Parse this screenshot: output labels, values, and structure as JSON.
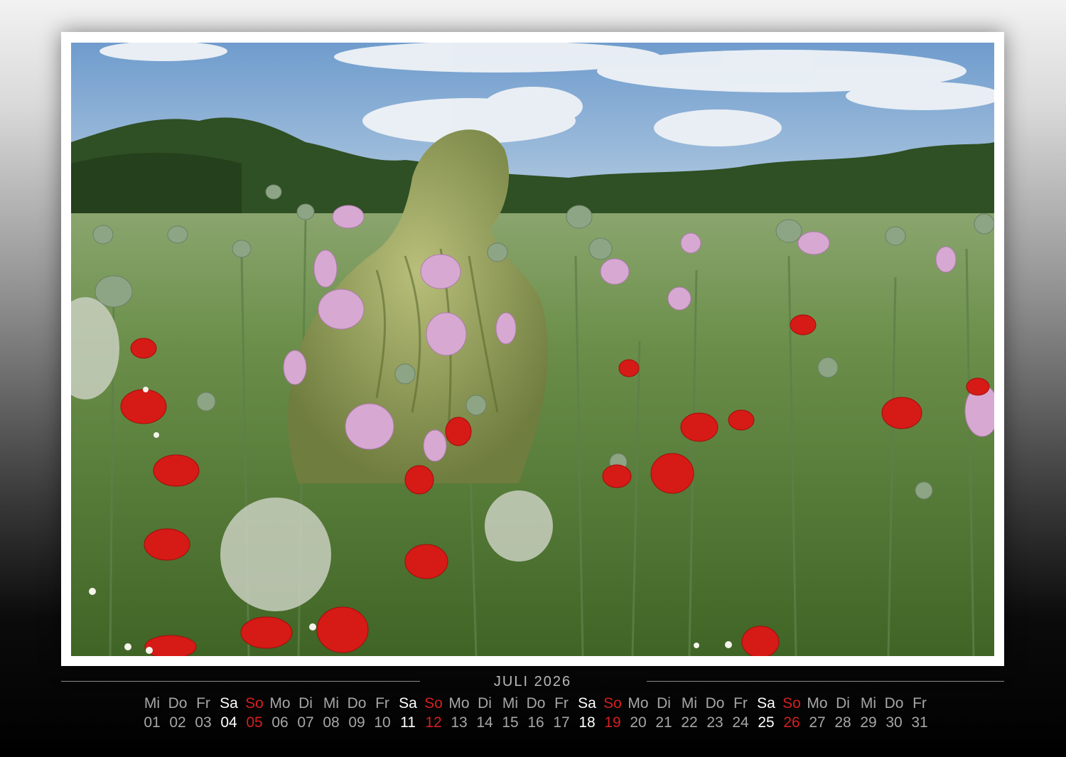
{
  "calendar": {
    "month_title": "JULI 2026",
    "days": [
      {
        "wd": "Mi",
        "d": "01",
        "type": "weekday"
      },
      {
        "wd": "Do",
        "d": "02",
        "type": "weekday"
      },
      {
        "wd": "Fr",
        "d": "03",
        "type": "weekday"
      },
      {
        "wd": "Sa",
        "d": "04",
        "type": "saturday"
      },
      {
        "wd": "So",
        "d": "05",
        "type": "sunday"
      },
      {
        "wd": "Mo",
        "d": "06",
        "type": "weekday"
      },
      {
        "wd": "Di",
        "d": "07",
        "type": "weekday"
      },
      {
        "wd": "Mi",
        "d": "08",
        "type": "weekday"
      },
      {
        "wd": "Do",
        "d": "09",
        "type": "weekday"
      },
      {
        "wd": "Fr",
        "d": "10",
        "type": "weekday"
      },
      {
        "wd": "Sa",
        "d": "11",
        "type": "saturday"
      },
      {
        "wd": "So",
        "d": "12",
        "type": "sunday"
      },
      {
        "wd": "Mo",
        "d": "13",
        "type": "weekday"
      },
      {
        "wd": "Di",
        "d": "14",
        "type": "weekday"
      },
      {
        "wd": "Mi",
        "d": "15",
        "type": "weekday"
      },
      {
        "wd": "Do",
        "d": "16",
        "type": "weekday"
      },
      {
        "wd": "Fr",
        "d": "17",
        "type": "weekday"
      },
      {
        "wd": "Sa",
        "d": "18",
        "type": "saturday"
      },
      {
        "wd": "So",
        "d": "19",
        "type": "sunday"
      },
      {
        "wd": "Mo",
        "d": "20",
        "type": "weekday"
      },
      {
        "wd": "Di",
        "d": "21",
        "type": "weekday"
      },
      {
        "wd": "Mi",
        "d": "22",
        "type": "weekday"
      },
      {
        "wd": "Do",
        "d": "23",
        "type": "weekday"
      },
      {
        "wd": "Fr",
        "d": "24",
        "type": "weekday"
      },
      {
        "wd": "Sa",
        "d": "25",
        "type": "saturday"
      },
      {
        "wd": "So",
        "d": "26",
        "type": "sunday"
      },
      {
        "wd": "Mo",
        "d": "27",
        "type": "weekday"
      },
      {
        "wd": "Di",
        "d": "28",
        "type": "weekday"
      },
      {
        "wd": "Mi",
        "d": "29",
        "type": "weekday"
      },
      {
        "wd": "Do",
        "d": "30",
        "type": "weekday"
      },
      {
        "wd": "Fr",
        "d": "31",
        "type": "weekday"
      }
    ]
  },
  "colors": {
    "weekday": "#a6a6a6",
    "saturday": "#ffffff",
    "sunday": "#d41f1f"
  }
}
